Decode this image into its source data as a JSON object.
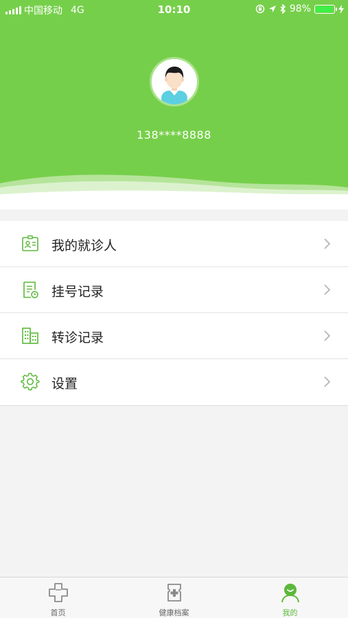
{
  "status_bar": {
    "carrier": "中国移动",
    "network": "4G",
    "time": "10:10",
    "battery_percent": "98%"
  },
  "profile": {
    "phone": "138****8888"
  },
  "menu": {
    "items": [
      {
        "label": "我的就诊人",
        "icon": "patient-card-icon"
      },
      {
        "label": "挂号记录",
        "icon": "registration-record-icon"
      },
      {
        "label": "转诊记录",
        "icon": "building-icon"
      },
      {
        "label": "设置",
        "icon": "gear-icon"
      }
    ]
  },
  "tabbar": {
    "tabs": [
      {
        "label": "首页",
        "icon": "medical-cross-icon",
        "active": false
      },
      {
        "label": "健康档案",
        "icon": "health-file-icon",
        "active": false
      },
      {
        "label": "我的",
        "icon": "user-icon",
        "active": true
      }
    ]
  },
  "colors": {
    "brand_green": "#76cf4a",
    "active_tab": "#5cb83a",
    "icon_green": "#5cb83a"
  }
}
